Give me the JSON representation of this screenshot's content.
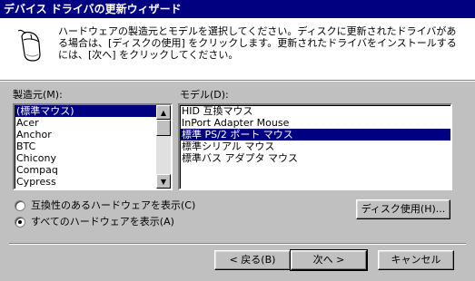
{
  "window": {
    "title": "デバイス ドライバの更新ウィザード"
  },
  "header": {
    "instruction": "ハードウェアの製造元とモデルを選択してください。ディスクに更新されたドライバがある場合は、[ディスクの使用] をクリックします。更新されたドライバをインストールするには、[次へ] をクリックしてください。",
    "icon": "mouse-icon"
  },
  "manufacturers": {
    "label": "製造元(M):",
    "items": [
      "(標準マウス)",
      "Acer",
      "Anchor",
      "BTC",
      "Chicony",
      "Compaq",
      "Cypress"
    ],
    "selected_index": 0
  },
  "models": {
    "label": "モデル(D):",
    "items": [
      "HID 互換マウス",
      "InPort Adapter Mouse",
      "標準 PS/2 ポート マウス",
      "標準シリアル マウス",
      "標準バス アダプタ マウス"
    ],
    "selected_index": 2
  },
  "options": {
    "compatible": "互換性のあるハードウェアを表示(C)",
    "all": "すべてのハードウェアを表示(A)",
    "selected": "all"
  },
  "buttons": {
    "have_disk": "ディスク使用(H)...",
    "back": "< 戻る(B)",
    "next": "次へ >",
    "cancel": "キャンセル"
  }
}
